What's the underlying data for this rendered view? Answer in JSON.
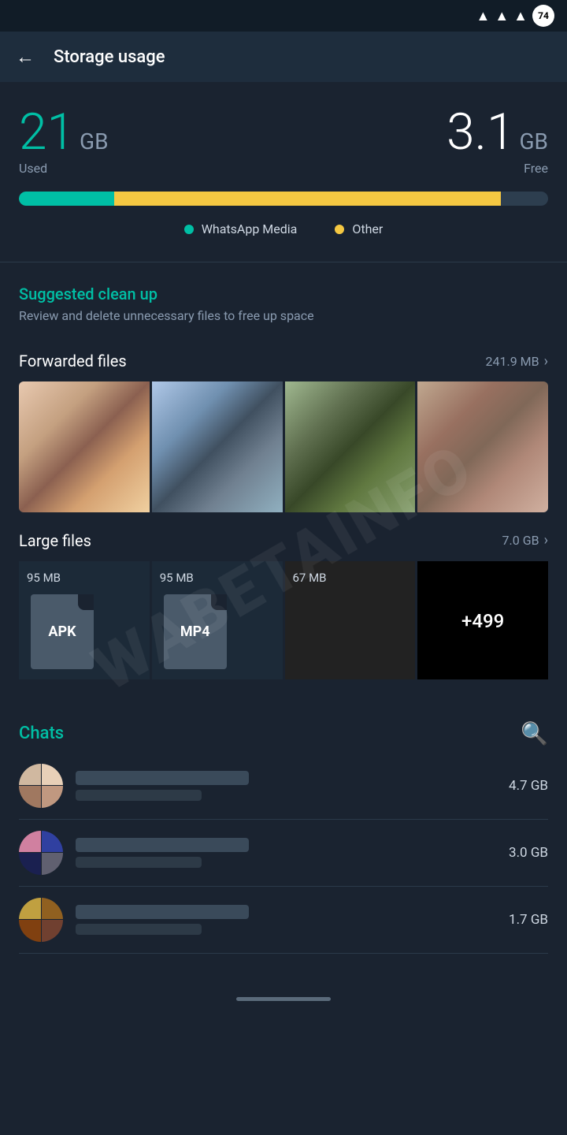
{
  "statusBar": {
    "batteryLabel": "74"
  },
  "topBar": {
    "title": "Storage usage",
    "backLabel": "←"
  },
  "storage": {
    "usedNumber": "21",
    "usedUnit": "GB",
    "usedLabel": "Used",
    "freeNumber": "3.1",
    "freeUnit": "GB",
    "freeLabel": "Free",
    "progressWhatsappWidth": "18%",
    "progressOtherWidth": "73%",
    "legendWhatsapp": "WhatsApp Media",
    "legendOther": "Other"
  },
  "suggestedCleanup": {
    "title": "Suggested clean up",
    "subtitle": "Review and delete unnecessary files to free up space"
  },
  "forwardedFiles": {
    "label": "Forwarded files",
    "size": "241.9 MB",
    "chevron": "›"
  },
  "largeFiles": {
    "label": "Large files",
    "size": "7.0 GB",
    "chevron": "›",
    "files": [
      {
        "size": "95 MB",
        "type": "APK"
      },
      {
        "size": "95 MB",
        "type": "MP4"
      },
      {
        "size": "67 MB",
        "type": ""
      },
      {
        "size": "",
        "type": "+499"
      }
    ]
  },
  "chats": {
    "title": "Chats",
    "searchIcon": "🔍",
    "items": [
      {
        "size": "4.7 GB"
      },
      {
        "size": "3.0 GB"
      },
      {
        "size": "1.7 GB"
      }
    ]
  },
  "homeBar": {}
}
